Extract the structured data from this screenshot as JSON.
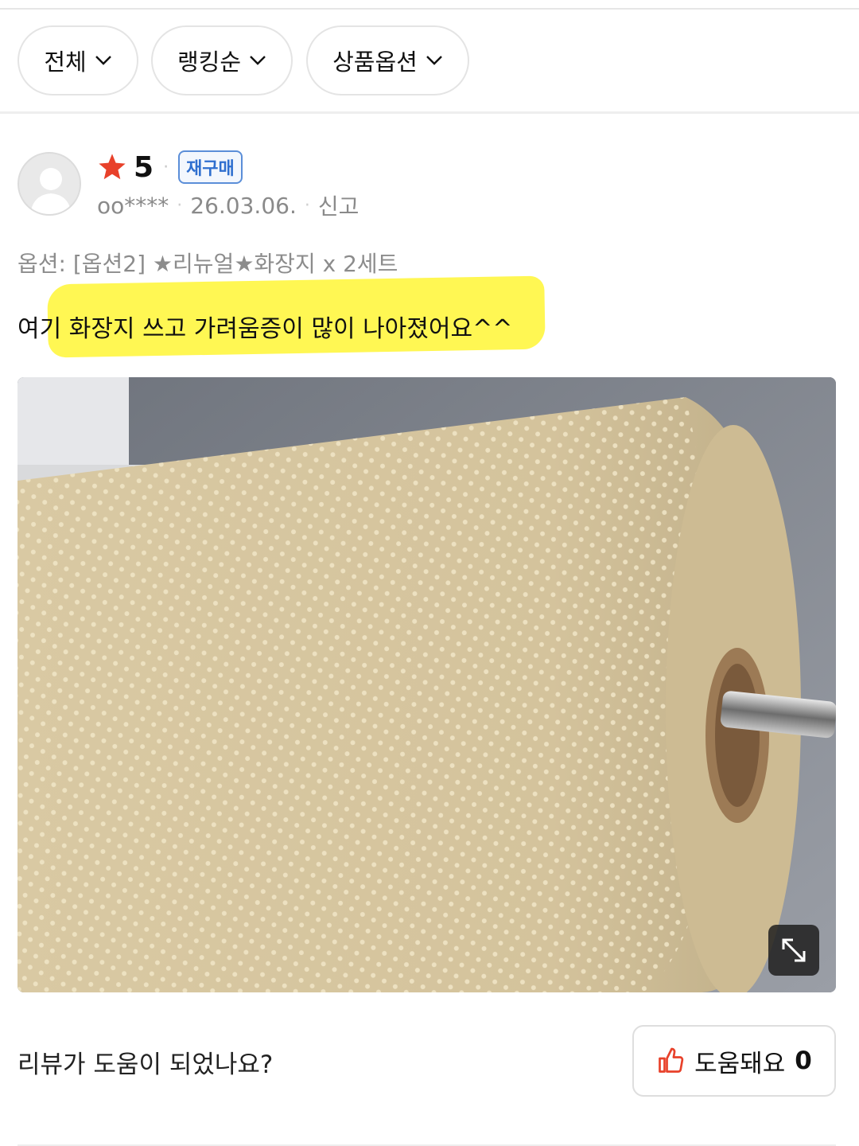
{
  "filters": [
    {
      "label": "전체"
    },
    {
      "label": "랭킹순"
    },
    {
      "label": "상품옵션"
    }
  ],
  "review": {
    "rating": "5",
    "badge": "재구매",
    "user": "oo****",
    "date": "26.03.06.",
    "report_label": "신고",
    "option_text": "옵션: [옵션2] ★리뉴얼★화장지 x 2세트",
    "body_text": "여기 화장지 쓰고 가려움증이 많이 나아졌어요^^",
    "photo_icon": "expand-icon"
  },
  "footer": {
    "question": "리뷰가 도움이 되었나요?",
    "helpful_label": "도움돼요",
    "helpful_count": "0"
  },
  "colors": {
    "star": "#e8412a",
    "badge": "#2f6fcf",
    "highlight": "#fff74a",
    "thumb": "#e8412a"
  }
}
